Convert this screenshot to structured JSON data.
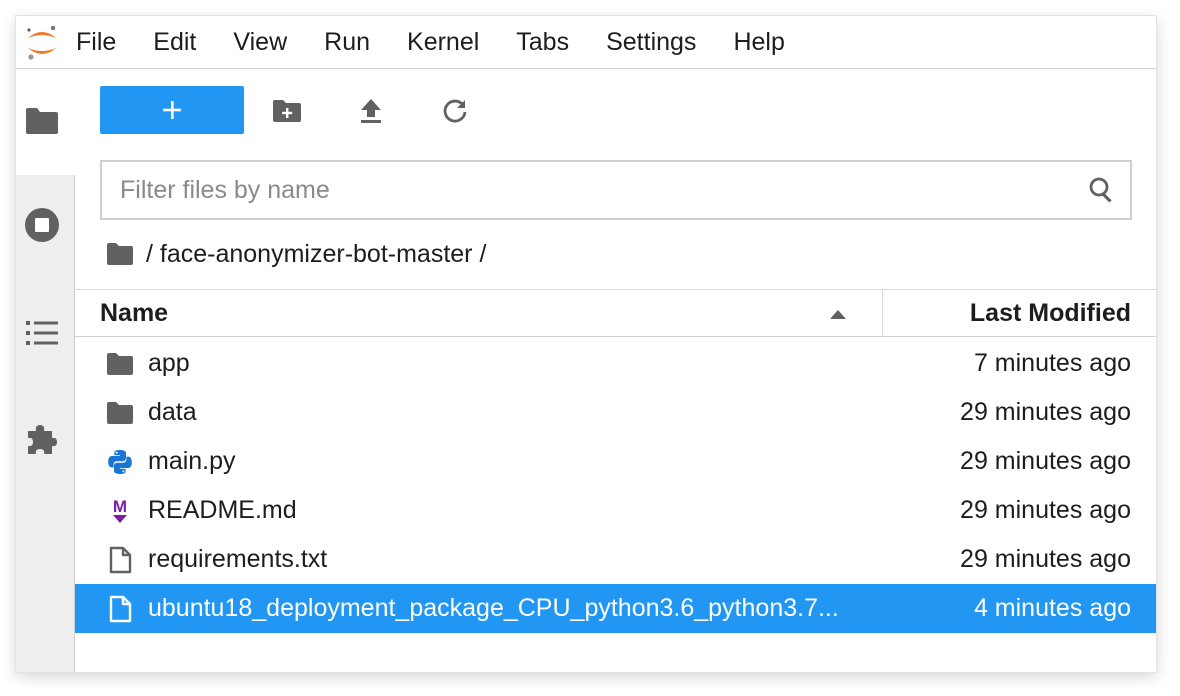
{
  "menu": {
    "items": [
      "File",
      "Edit",
      "View",
      "Run",
      "Kernel",
      "Tabs",
      "Settings",
      "Help"
    ]
  },
  "sidebar": {
    "items": [
      {
        "icon": "folder-icon",
        "active": true
      },
      {
        "icon": "stop-circle-icon",
        "active": false
      },
      {
        "icon": "list-icon",
        "active": false
      },
      {
        "icon": "puzzle-icon",
        "active": false
      }
    ]
  },
  "toolbar": {
    "new_label": "+",
    "icons": [
      "new-folder-icon",
      "upload-icon",
      "refresh-icon"
    ]
  },
  "filter": {
    "placeholder": "Filter files by name",
    "value": ""
  },
  "breadcrumb": {
    "path": "/ face-anonymizer-bot-master /"
  },
  "list": {
    "columns": {
      "name": "Name",
      "modified": "Last Modified"
    },
    "sort": "ascending",
    "files": [
      {
        "name": "app",
        "modified": "7 minutes ago",
        "type": "folder",
        "selected": false
      },
      {
        "name": "data",
        "modified": "29 minutes ago",
        "type": "folder",
        "selected": false
      },
      {
        "name": "main.py",
        "modified": "29 minutes ago",
        "type": "python",
        "selected": false
      },
      {
        "name": "README.md",
        "modified": "29 minutes ago",
        "type": "markdown",
        "selected": false
      },
      {
        "name": "requirements.txt",
        "modified": "29 minutes ago",
        "type": "file",
        "selected": false
      },
      {
        "name": "ubuntu18_deployment_package_CPU_python3.6_python3.7...",
        "modified": "4 minutes ago",
        "type": "file",
        "selected": true
      }
    ]
  },
  "colors": {
    "accent": "#2196f3",
    "icon": "#616161",
    "markdown": "#7b1fa2",
    "python_blue": "#1976d2",
    "python_yellow": "#ffca28",
    "logo_orange": "#f37626"
  }
}
